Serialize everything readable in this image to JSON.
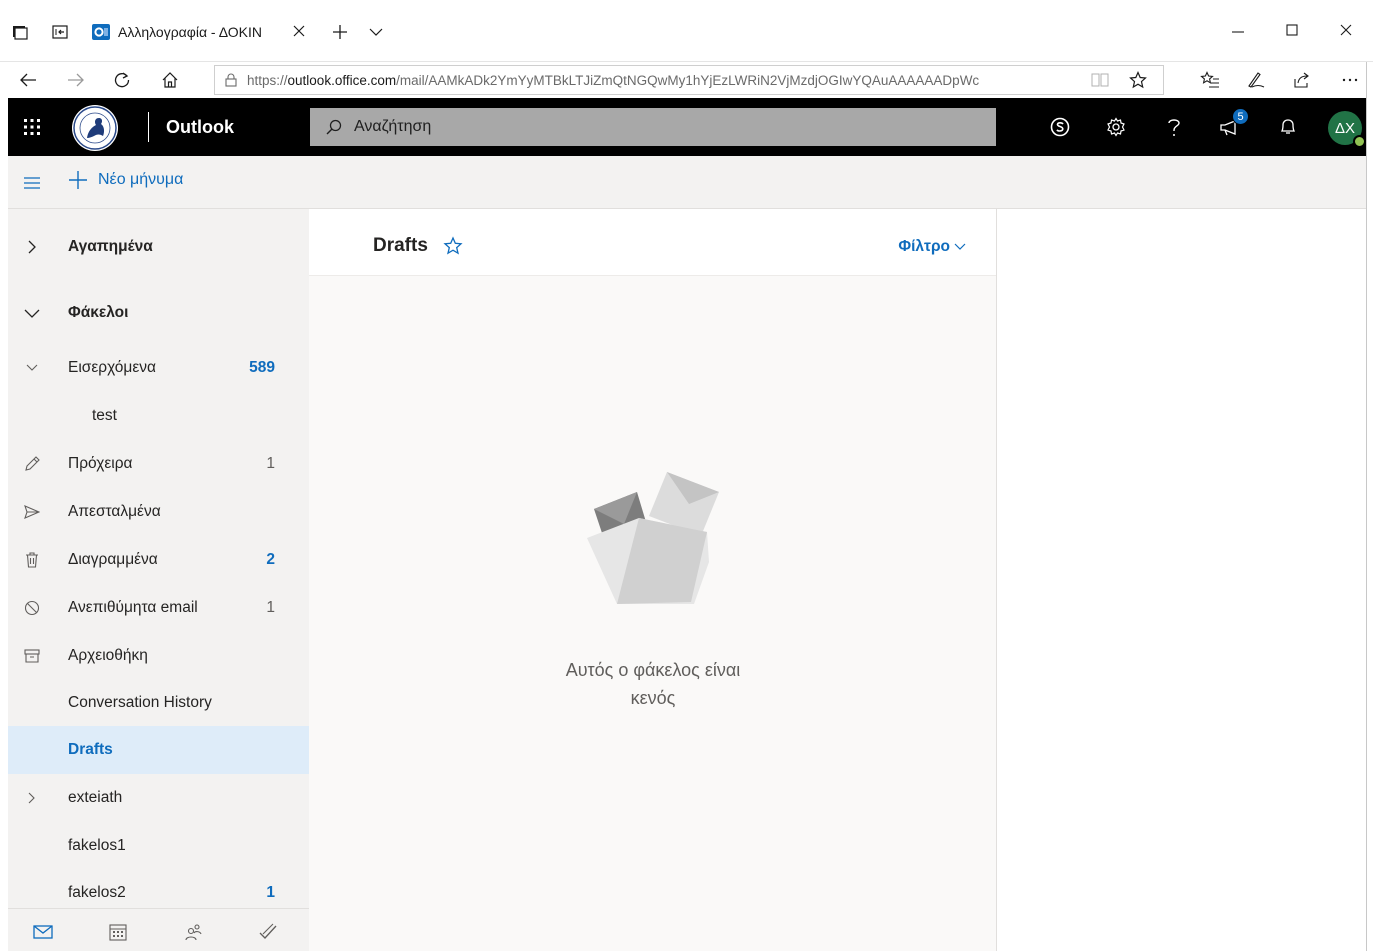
{
  "browser": {
    "tab_title": "Αλληλογραφία - ΔΟΚΙΝ",
    "url_prefix": "https://",
    "url_host": "outlook.office.com",
    "url_path": "/mail/AAMkADk2YmYyMTBkLTJiZmQtNGQwMy1hYjEzLWRiN2VjMzdjOGIwYQAuAAAAAADpWc"
  },
  "header": {
    "brand": "Outlook",
    "search_placeholder": "Αναζήτηση",
    "notification_count": "5",
    "avatar_initials": "ΔΧ"
  },
  "command_bar": {
    "new_message_label": "Νέο μήνυμα"
  },
  "folders": {
    "favorites_label": "Αγαπημένα",
    "folders_label": "Φάκελοι",
    "items": [
      {
        "label": "Εισερχόμενα",
        "count": "589"
      },
      {
        "label": "test",
        "count": ""
      },
      {
        "label": "Πρόχειρα",
        "count": "1"
      },
      {
        "label": "Απεσταλμένα",
        "count": ""
      },
      {
        "label": "Διαγραμμένα",
        "count": "2"
      },
      {
        "label": "Ανεπιθύμητα email",
        "count": "1"
      },
      {
        "label": "Αρχειοθήκη",
        "count": ""
      },
      {
        "label": "Conversation History",
        "count": ""
      },
      {
        "label": "Drafts",
        "count": ""
      },
      {
        "label": "exteiath",
        "count": ""
      },
      {
        "label": "fakelos1",
        "count": ""
      },
      {
        "label": "fakelos2",
        "count": "1"
      }
    ]
  },
  "message_list": {
    "title": "Drafts",
    "filter_label": "Φίλτρο",
    "empty_line1": "Αυτός ο φάκελος είναι",
    "empty_line2": "κενός"
  },
  "colors": {
    "accent": "#0f6cbd",
    "header_bg": "#000000",
    "pane_bg": "#f3f2f1",
    "selected_bg": "#deecf9",
    "avatar_bg": "#217346"
  }
}
